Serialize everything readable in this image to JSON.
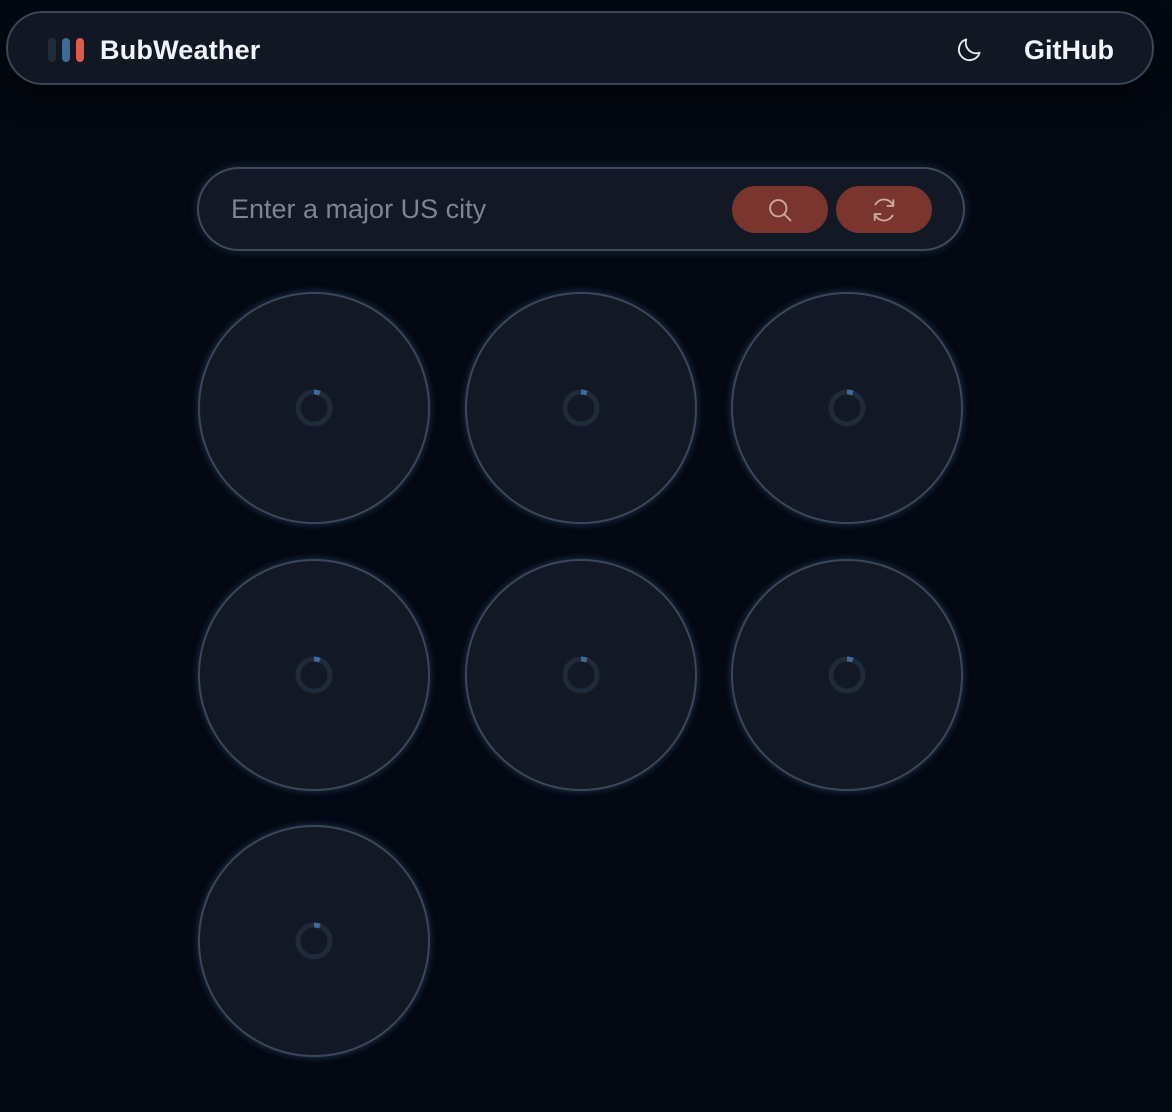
{
  "navbar": {
    "brand": "BubWeather",
    "github_label": "GitHub",
    "logo_colors": [
      "#222b38",
      "#3d6a96",
      "#e2584a"
    ],
    "theme_icon": "moon-icon"
  },
  "search": {
    "placeholder": "Enter a major US city",
    "value": "",
    "search_icon": "search-icon",
    "refresh_icon": "refresh-icon",
    "button_color": "#7a352e"
  },
  "bubbles": {
    "count": 7,
    "state": "loading",
    "spinner_icon": "loading-spinner-icon"
  },
  "colors": {
    "background": "#030812",
    "surface": "#121824",
    "border": "#3b4759",
    "accent": "#e2584a"
  }
}
